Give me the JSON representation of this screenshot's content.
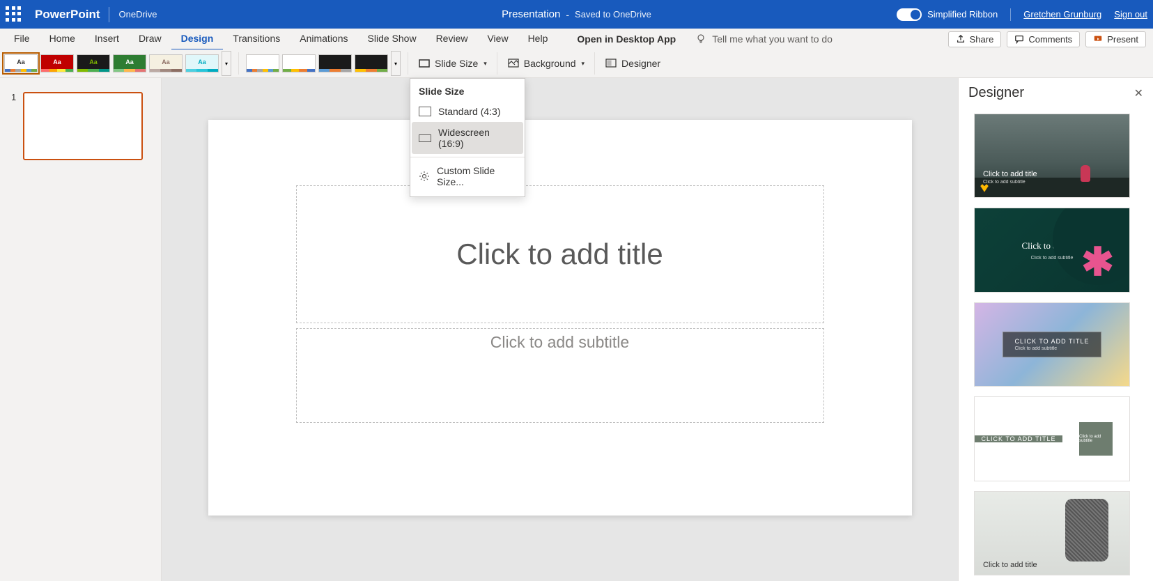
{
  "title_bar": {
    "app_name": "PowerPoint",
    "storage": "OneDrive",
    "doc_name": "Presentation",
    "dash": "-",
    "save_status": "Saved to OneDrive",
    "simplified_label": "Simplified Ribbon",
    "user_name": "Gretchen Grunburg",
    "sign_out": "Sign out"
  },
  "ribbon_tabs": {
    "items": [
      "File",
      "Home",
      "Insert",
      "Draw",
      "Design",
      "Transitions",
      "Animations",
      "Slide Show",
      "Review",
      "View",
      "Help"
    ],
    "active": "Design",
    "open_desktop": "Open in Desktop App",
    "tell_me_placeholder": "Tell me what you want to do"
  },
  "ribbon_actions": {
    "share": "Share",
    "comments": "Comments",
    "present": "Present"
  },
  "design_ribbon": {
    "slide_size": "Slide Size",
    "background": "Background",
    "designer": "Designer"
  },
  "slide_size_menu": {
    "title": "Slide Size",
    "standard": "Standard (4:3)",
    "widescreen": "Widescreen (16:9)",
    "custom": "Custom Slide Size..."
  },
  "slide_panel": {
    "slides": [
      {
        "number": "1"
      }
    ]
  },
  "canvas": {
    "title_placeholder": "Click to add title",
    "subtitle_placeholder": "Click to add subtitle"
  },
  "designer_pane": {
    "title": "Designer",
    "suggestions": [
      {
        "title": "Click to add title",
        "subtitle": "Click to add subtitle"
      },
      {
        "title": "Click to add title",
        "subtitle": "Click to add subtitle"
      },
      {
        "title": "CLICK TO ADD TITLE",
        "subtitle": "Click to add subtitle"
      },
      {
        "title": "CLICK TO ADD TITLE",
        "subtitle": "Click to add subtitle"
      },
      {
        "title": "Click to add title",
        "subtitle": ""
      }
    ]
  },
  "theme_thumbs": {
    "letter": "Aa"
  }
}
